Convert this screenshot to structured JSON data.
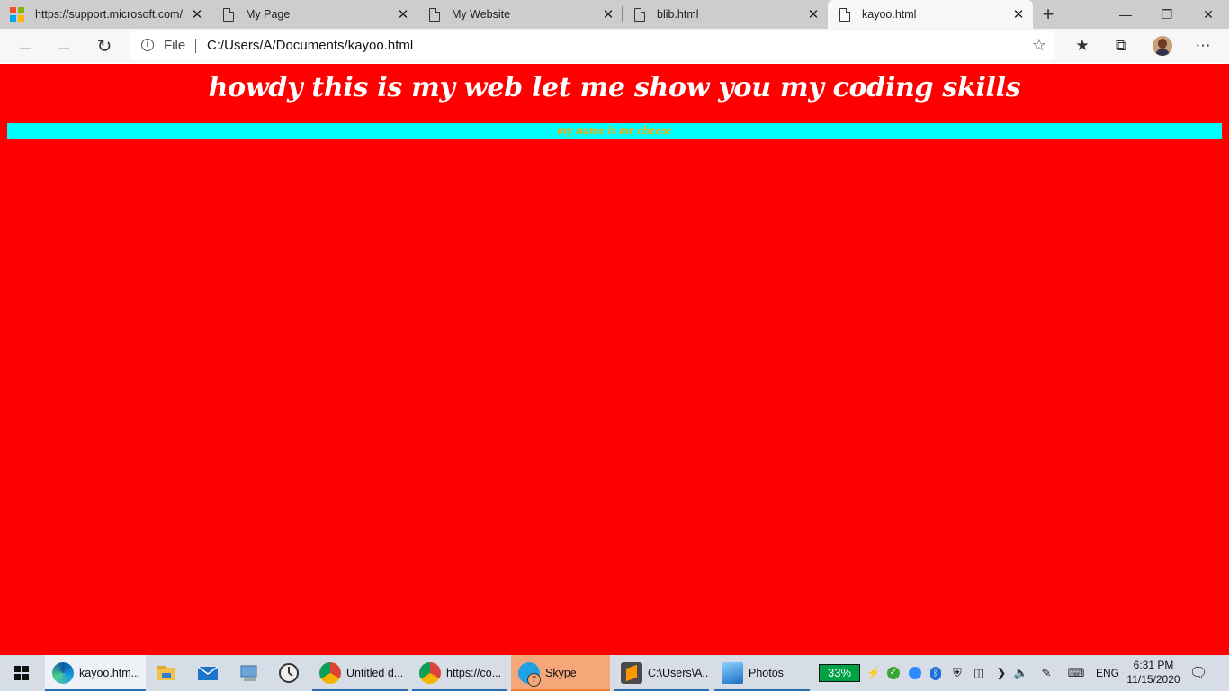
{
  "browser": {
    "tabs": [
      {
        "label": "https://support.microsoft.com/",
        "icon": "microsoft-logo-icon",
        "active": false
      },
      {
        "label": "My Page",
        "icon": "file-icon",
        "active": false
      },
      {
        "label": "My Website",
        "icon": "file-icon",
        "active": false
      },
      {
        "label": "blib.html",
        "icon": "file-icon",
        "active": false
      },
      {
        "label": "kayoo.html",
        "icon": "file-icon",
        "active": true
      }
    ],
    "new_tab_glyph": "+",
    "window_controls": {
      "minimize": "—",
      "restore": "❐",
      "close": "✕"
    },
    "address": {
      "scheme_label": "File",
      "url": "C:/Users/A/Documents/kayoo.html"
    }
  },
  "page": {
    "heading": "howdy this is my web let me show you my coding skills",
    "band_text": "my name is mr cheese",
    "colors": {
      "background": "#ff0000",
      "band": "#00ffff",
      "band_text": "#ffa500",
      "heading": "#ffffff"
    }
  },
  "taskbar": {
    "items": [
      {
        "label": "kayoo.htm...",
        "icon": "edge-icon"
      },
      {
        "label": "",
        "icon": "file-explorer-icon"
      },
      {
        "label": "",
        "icon": "mail-icon"
      },
      {
        "label": "",
        "icon": "computer-icon"
      },
      {
        "label": "",
        "icon": "clock-app-icon"
      },
      {
        "label": "Untitled d...",
        "icon": "chrome-icon"
      },
      {
        "label": "https://co...",
        "icon": "chrome-icon"
      },
      {
        "label": "Skype",
        "icon": "skype-icon",
        "badge": "7"
      },
      {
        "label": "C:\\Users\\A...",
        "icon": "sublime-text-icon"
      },
      {
        "label": "Photos",
        "icon": "photos-icon"
      }
    ],
    "tray": {
      "battery": "33%",
      "language": "ENG",
      "time": "6:31 PM",
      "date": "11/15/2020"
    }
  }
}
